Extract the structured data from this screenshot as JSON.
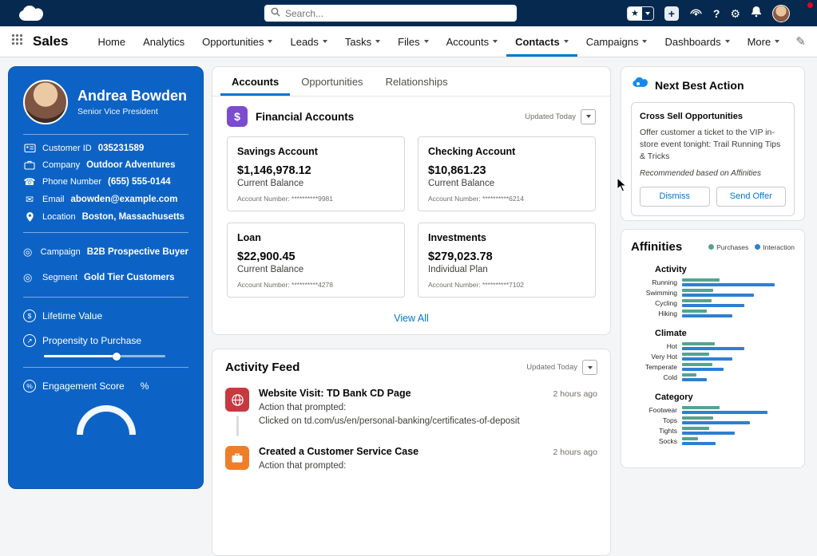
{
  "icons": {
    "star": "★",
    "plus": "+",
    "help": "?",
    "gear": "⚙",
    "pencil": "✎",
    "phone": "☎",
    "email": "✉",
    "target": "◎",
    "dollar": "$",
    "arrow_up": "↗",
    "percent_glyph": "%"
  },
  "topbar": {
    "search_placeholder": "Search..."
  },
  "navbar": {
    "app_name": "Sales",
    "active_item": "Contacts",
    "items": [
      {
        "label": "Home",
        "caret": false
      },
      {
        "label": "Analytics",
        "caret": false
      },
      {
        "label": "Opportunities",
        "caret": true
      },
      {
        "label": "Leads",
        "caret": true
      },
      {
        "label": "Tasks",
        "caret": true
      },
      {
        "label": "Files",
        "caret": true
      },
      {
        "label": "Accounts",
        "caret": true
      },
      {
        "label": "Contacts",
        "caret": true
      },
      {
        "label": "Campaigns",
        "caret": true
      },
      {
        "label": "Dashboards",
        "caret": true
      },
      {
        "label": "More",
        "caret": true
      }
    ]
  },
  "profile": {
    "name": "Andrea Bowden",
    "title": "Senior Vice President",
    "fields": [
      {
        "label": "Customer ID",
        "value": "035231589"
      },
      {
        "label": "Company",
        "value": "Outdoor Adventures"
      },
      {
        "label": "Phone Number",
        "value": "(655) 555-0144"
      },
      {
        "label": "Email",
        "value": "abowden@example.com"
      },
      {
        "label": "Location",
        "value": "Boston, Massachusetts"
      }
    ],
    "attributes": [
      {
        "label": "Campaign",
        "value": "B2B Prospective Buyer"
      },
      {
        "label": "Segment",
        "value": "Gold Tier Customers"
      }
    ],
    "metrics": {
      "lifetime_value_label": "Lifetime Value",
      "propensity_label": "Propensity to Purchase",
      "propensity_pct": 60,
      "engagement_label": "Engagement Score",
      "engagement_unit": "%"
    }
  },
  "main": {
    "tabs": [
      {
        "label": "Accounts"
      },
      {
        "label": "Opportunities"
      },
      {
        "label": "Relationships"
      }
    ],
    "active_tab": "Accounts",
    "financial_accounts": {
      "title": "Financial Accounts",
      "updated": "Updated Today",
      "view_all": "View All",
      "accounts": [
        {
          "name": "Savings Account",
          "amount": "$1,146,978.12",
          "plan": "Current Balance",
          "account_number": "Account Number: **********9981"
        },
        {
          "name": "Checking Account",
          "amount": "$10,861.23",
          "plan": "Current Balance",
          "account_number": "Account Number: **********6214"
        },
        {
          "name": "Loan",
          "amount": "$22,900.45",
          "plan": "Current Balance",
          "account_number": "Account Number: **********4278"
        },
        {
          "name": "Investments",
          "amount": "$279,023.78",
          "plan": "Individual Plan",
          "account_number": "Account Number: **********7102"
        }
      ]
    },
    "activity_feed": {
      "title": "Activity Feed",
      "updated": "Updated Today",
      "items": [
        {
          "title": "Website Visit: TD Bank CD Page",
          "time": "2 hours ago",
          "line1": "Action that prompted:",
          "line2": "Clicked on td.com/us/en/personal-banking/certificates-of-deposit"
        },
        {
          "title": "Created a Customer Service Case",
          "time": "2 hours ago",
          "line1": "Action that prompted:",
          "line2": ""
        }
      ]
    }
  },
  "right": {
    "next_best_action": {
      "title": "Next Best Action",
      "card_title": "Cross Sell Opportunities",
      "body": "Offer customer a ticket to the VIP in-store event tonight: Trail Running Tips & Tricks",
      "note": "Recommended based on Affinities",
      "dismiss_label": "Dismiss",
      "send_label": "Send Offer"
    },
    "affinities": {
      "title": "Affinities",
      "legend": [
        {
          "label": "Purchases",
          "color": "#55a390"
        },
        {
          "label": "Interaction",
          "color": "#2e7fd2"
        }
      ]
    }
  },
  "chart_data": {
    "type": "bar",
    "title": "Affinities",
    "orientation": "horizontal",
    "legend": [
      "Purchases",
      "Interaction"
    ],
    "legend_position": "top-right",
    "xlim": [
      0,
      100
    ],
    "groups": [
      {
        "name": "Activity",
        "rows": [
          {
            "label": "Running",
            "purchases": 33,
            "interaction": 82
          },
          {
            "label": "Swimming",
            "purchases": 28,
            "interaction": 64
          },
          {
            "label": "Cycling",
            "purchases": 26,
            "interaction": 55
          },
          {
            "label": "Hiking",
            "purchases": 22,
            "interaction": 45
          }
        ]
      },
      {
        "name": "Climate",
        "rows": [
          {
            "label": "Hot",
            "purchases": 29,
            "interaction": 55
          },
          {
            "label": "Very Hot",
            "purchases": 24,
            "interaction": 45
          },
          {
            "label": "Temperate",
            "purchases": 27,
            "interaction": 37
          },
          {
            "label": "Cold",
            "purchases": 13,
            "interaction": 22
          }
        ]
      },
      {
        "name": "Category",
        "rows": [
          {
            "label": "Footwear",
            "purchases": 33,
            "interaction": 76
          },
          {
            "label": "Tops",
            "purchases": 28,
            "interaction": 60
          },
          {
            "label": "Tights",
            "purchases": 24,
            "interaction": 47
          },
          {
            "label": "Socks",
            "purchases": 14,
            "interaction": 30
          }
        ]
      }
    ]
  }
}
